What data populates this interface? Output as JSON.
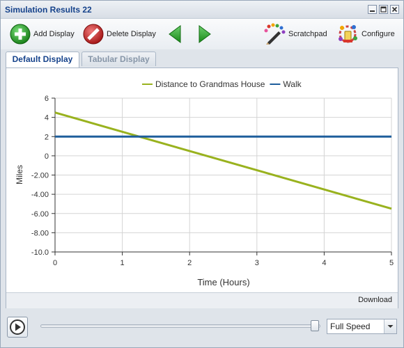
{
  "window": {
    "title": "Simulation Results 22"
  },
  "toolbar": {
    "add_display": "Add Display",
    "delete_display": "Delete Display",
    "scratchpad": "Scratchpad",
    "configure": "Configure"
  },
  "tabs": [
    {
      "label": "Default Display",
      "active": true
    },
    {
      "label": "Tabular Display",
      "active": false
    }
  ],
  "footer": {
    "download": "Download"
  },
  "playback": {
    "speed": "Full Speed",
    "progress": 1.0
  },
  "colors": {
    "series1": "#99b21e",
    "series2": "#1f5e9c",
    "accent": "#15428b"
  },
  "chart_data": {
    "type": "line",
    "xlabel": "Time (Hours)",
    "ylabel": "Miles",
    "xlim": [
      0,
      5
    ],
    "ylim": [
      -10,
      6
    ],
    "xticks": [
      0,
      1,
      2,
      3,
      4,
      5
    ],
    "xtick_labels": [
      "0",
      "1",
      "2",
      "3",
      "4",
      "5"
    ],
    "yticks": [
      6,
      4,
      2,
      0,
      -2,
      -4,
      -6,
      -8,
      -10
    ],
    "ytick_labels": [
      "6",
      "4",
      "2",
      "0",
      "-2.00",
      "-4.00",
      "-6.00",
      "-8.00",
      "-10.0"
    ],
    "grid": true,
    "legend": "top-center",
    "series": [
      {
        "name": "Distance to Grandmas House",
        "x": [
          0,
          5
        ],
        "values": [
          4.5,
          -5.5
        ]
      },
      {
        "name": "Walk",
        "x": [
          0,
          5
        ],
        "values": [
          2,
          2
        ]
      }
    ]
  }
}
